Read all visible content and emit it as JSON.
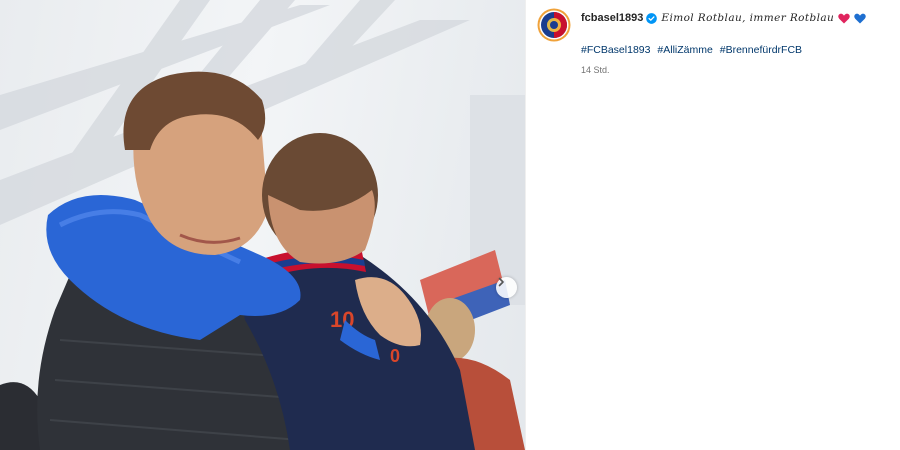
{
  "post": {
    "username": "fcbasel1893",
    "motto": "Eimol Rotblau, immer Rotblau",
    "hashtags": [
      "#FCBasel1893",
      "#AlliZämme",
      "#BrennefürdrFCB"
    ],
    "timestamp": "14 Std.",
    "jersey_number": "10"
  },
  "icons": {
    "verified": "verified-badge-icon",
    "heart_red": "red-heart-icon",
    "heart_blue": "blue-heart-icon",
    "next": "chevron-right-icon"
  },
  "colors": {
    "verified": "#0095f6",
    "heart_red": "#e0245e",
    "heart_blue": "#1e6fd0",
    "hashtag": "#00376b",
    "club_red": "#c8102e",
    "club_blue": "#1a3d8f"
  }
}
